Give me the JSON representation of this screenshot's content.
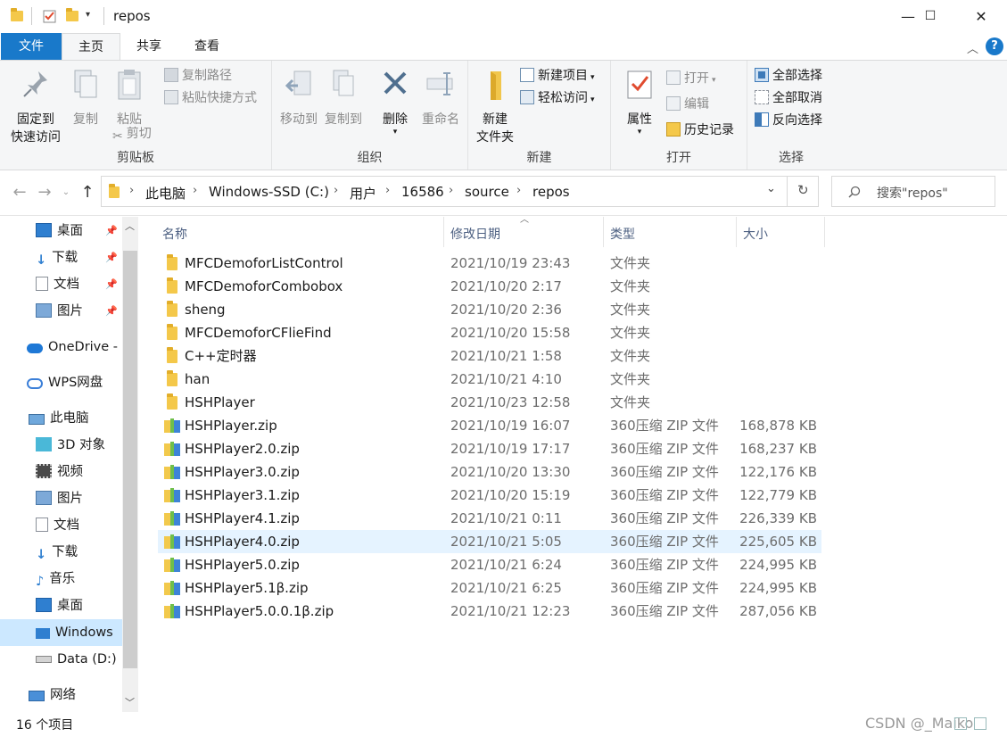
{
  "window": {
    "title": "repos",
    "minimize": "—",
    "maximize": "☐",
    "close": "✕"
  },
  "ribbon_tabs": [
    "文件",
    "主页",
    "共享",
    "查看"
  ],
  "ribbon": {
    "clipboard": {
      "label": "剪贴板",
      "pin_line1": "固定到",
      "pin_line2": "快速访问",
      "copy": "复制",
      "paste": "粘贴",
      "copy_path": "复制路径",
      "paste_shortcut": "粘贴快捷方式",
      "cut": "剪切"
    },
    "organize": {
      "label": "组织",
      "move_to": "移动到",
      "copy_to": "复制到",
      "delete": "删除",
      "rename": "重命名"
    },
    "new": {
      "label": "新建",
      "new_folder_line1": "新建",
      "new_folder_line2": "文件夹",
      "new_item": "新建项目",
      "easy_access": "轻松访问"
    },
    "open": {
      "label": "打开",
      "properties": "属性",
      "open": "打开",
      "edit": "编辑",
      "history": "历史记录"
    },
    "select": {
      "label": "选择",
      "select_all": "全部选择",
      "select_none": "全部取消",
      "invert": "反向选择"
    }
  },
  "address": {
    "crumbs": [
      "此电脑",
      "Windows-SSD (C:)",
      "用户",
      "16586",
      "source",
      "repos"
    ],
    "search_placeholder": "搜索\"repos\""
  },
  "nav_pane": {
    "quick_access": [
      "桌面",
      "下载",
      "文档",
      "图片"
    ],
    "onedrive": "OneDrive -",
    "wps": "WPS网盘",
    "this_pc": "此电脑",
    "pc_items": [
      "3D 对象",
      "视频",
      "图片",
      "文档",
      "下载",
      "音乐",
      "桌面",
      "Windows",
      "Data (D:)"
    ],
    "network": "网络"
  },
  "columns": [
    "名称",
    "修改日期",
    "类型",
    "大小"
  ],
  "files": [
    {
      "name": "MFCDemoforListControl",
      "date": "2021/10/19 23:43",
      "type": "文件夹",
      "size": "",
      "kind": "folder"
    },
    {
      "name": "MFCDemoforCombobox",
      "date": "2021/10/20 2:17",
      "type": "文件夹",
      "size": "",
      "kind": "folder"
    },
    {
      "name": "sheng",
      "date": "2021/10/20 2:36",
      "type": "文件夹",
      "size": "",
      "kind": "folder"
    },
    {
      "name": "MFCDemoforCFlieFind",
      "date": "2021/10/20 15:58",
      "type": "文件夹",
      "size": "",
      "kind": "folder"
    },
    {
      "name": "C++定时器",
      "date": "2021/10/21 1:58",
      "type": "文件夹",
      "size": "",
      "kind": "folder"
    },
    {
      "name": "han",
      "date": "2021/10/21 4:10",
      "type": "文件夹",
      "size": "",
      "kind": "folder"
    },
    {
      "name": "HSHPlayer",
      "date": "2021/10/23 12:58",
      "type": "文件夹",
      "size": "",
      "kind": "folder"
    },
    {
      "name": "HSHPlayer.zip",
      "date": "2021/10/19 16:07",
      "type": "360压缩 ZIP 文件",
      "size": "168,878 KB",
      "kind": "zip"
    },
    {
      "name": "HSHPlayer2.0.zip",
      "date": "2021/10/19 17:17",
      "type": "360压缩 ZIP 文件",
      "size": "168,237 KB",
      "kind": "zip"
    },
    {
      "name": "HSHPlayer3.0.zip",
      "date": "2021/10/20 13:30",
      "type": "360压缩 ZIP 文件",
      "size": "122,176 KB",
      "kind": "zip"
    },
    {
      "name": "HSHPlayer3.1.zip",
      "date": "2021/10/20 15:19",
      "type": "360压缩 ZIP 文件",
      "size": "122,779 KB",
      "kind": "zip"
    },
    {
      "name": "HSHPlayer4.1.zip",
      "date": "2021/10/21 0:11",
      "type": "360压缩 ZIP 文件",
      "size": "226,339 KB",
      "kind": "zip"
    },
    {
      "name": "HSHPlayer4.0.zip",
      "date": "2021/10/21 5:05",
      "type": "360压缩 ZIP 文件",
      "size": "225,605 KB",
      "kind": "zip",
      "selected": true
    },
    {
      "name": "HSHPlayer5.0.zip",
      "date": "2021/10/21 6:24",
      "type": "360压缩 ZIP 文件",
      "size": "224,995 KB",
      "kind": "zip"
    },
    {
      "name": "HSHPlayer5.1β.zip",
      "date": "2021/10/21 6:25",
      "type": "360压缩 ZIP 文件",
      "size": "224,995 KB",
      "kind": "zip"
    },
    {
      "name": "HSHPlayer5.0.0.1β.zip",
      "date": "2021/10/21 12:23",
      "type": "360压缩 ZIP 文件",
      "size": "287,056 KB",
      "kind": "zip"
    }
  ],
  "status": "16 个项目",
  "watermark": "CSDN @_Maiko"
}
